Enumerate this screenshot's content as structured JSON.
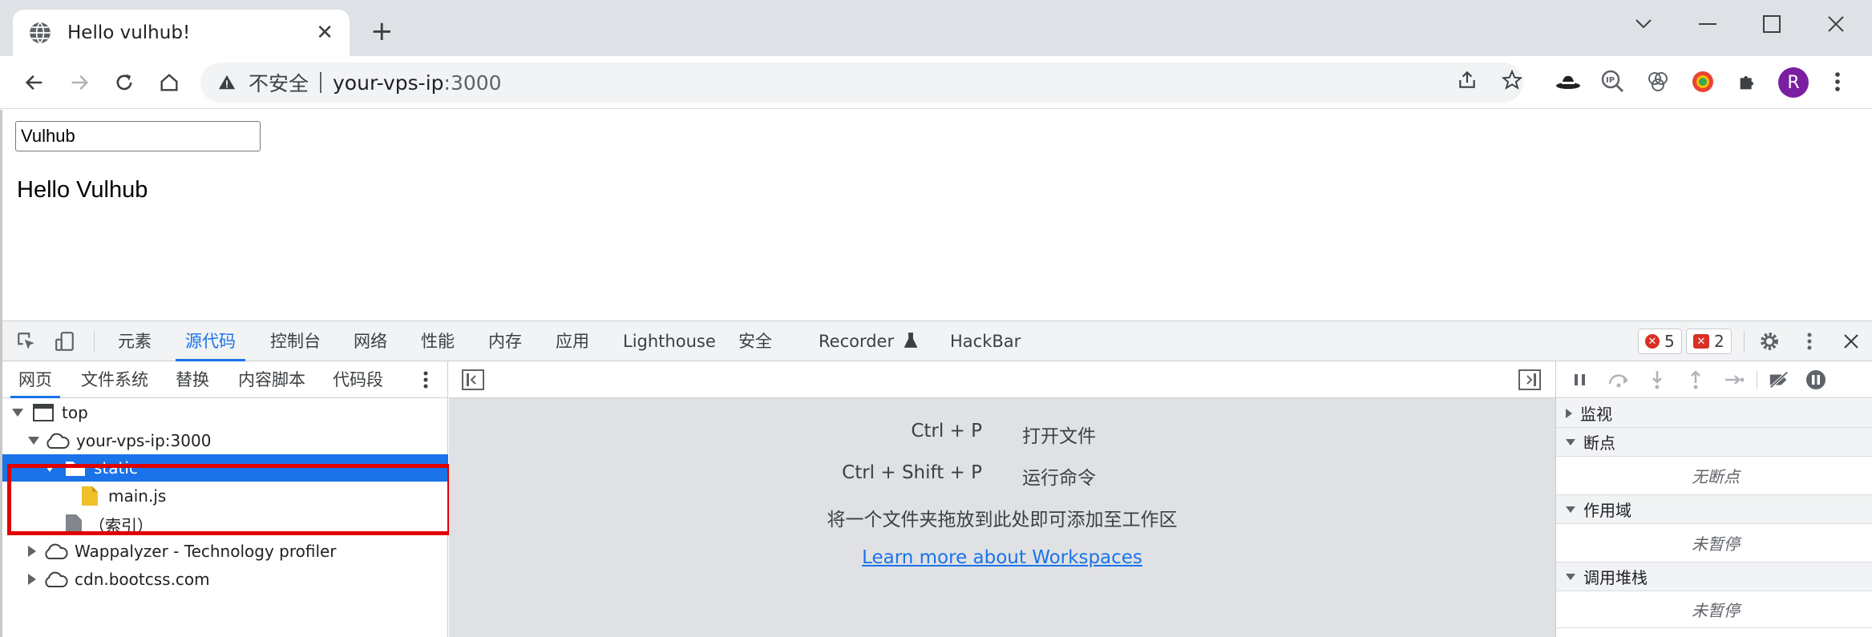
{
  "browser": {
    "tab_title": "Hello vulhub!",
    "omnibox": {
      "security_label": "不安全",
      "host": "your-vps-ip",
      "port": ":3000"
    },
    "avatar_letter": "R"
  },
  "page": {
    "input_value": "Vulhub",
    "text": "Hello Vulhub"
  },
  "devtools": {
    "tabs": [
      "元素",
      "源代码",
      "控制台",
      "网络",
      "性能",
      "内存",
      "应用",
      "Lighthouse",
      "安全",
      "Recorder",
      "HackBar"
    ],
    "active_tab": "源代码",
    "error_count": "5",
    "issue_count": "2",
    "navigator": {
      "tabs": [
        "网页",
        "文件系统",
        "替换",
        "内容脚本",
        "代码段"
      ],
      "tree": [
        {
          "label": "top",
          "level": 0,
          "icon": "frame-icon"
        },
        {
          "label": "your-vps-ip:3000",
          "level": 1,
          "icon": "cloud-icon"
        },
        {
          "label": "static",
          "level": 2,
          "icon": "folder-icon"
        },
        {
          "label": "main.js",
          "level": 3,
          "icon": "file-icon"
        },
        {
          "label": "（索引）",
          "level": 2,
          "icon": "file-icon"
        },
        {
          "label": "Wappalyzer - Technology profiler",
          "level": 1,
          "icon": "cloud-icon"
        },
        {
          "label": "cdn.bootcss.com",
          "level": 1,
          "icon": "cloud-icon"
        }
      ]
    },
    "editor": {
      "shortcuts": [
        {
          "key": "Ctrl + P",
          "desc": "打开文件"
        },
        {
          "key": "Ctrl + Shift + P",
          "desc": "运行命令"
        }
      ],
      "drop_hint": "将一个文件夹拖放到此处即可添加至工作区",
      "learn_link": "Learn more about Workspaces"
    },
    "debugger": {
      "watch": "监视",
      "breakpoints": "断点",
      "no_breakpoints": "无断点",
      "scope": "作用域",
      "not_paused_1": "未暂停",
      "callstack": "调用堆栈",
      "not_paused_2": "未暂停"
    }
  },
  "colors": {
    "accent": "#1a73e8",
    "highlight_box": "#e00000",
    "error": "#d93025",
    "avatar": "#7b1fa2"
  }
}
